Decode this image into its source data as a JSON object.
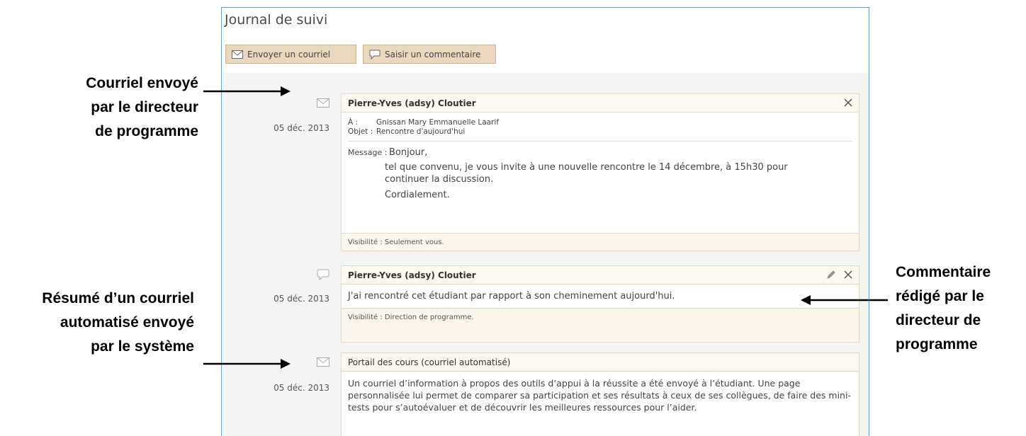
{
  "annotations": {
    "email_sent": [
      "Courriel envoyé",
      "par le directeur",
      "de programme"
    ],
    "auto_email": [
      "Résumé d’un courriel",
      "automatisé envoyé",
      "par le système"
    ],
    "comment": [
      "Commentaire",
      "rédigé par le",
      "directeur de",
      "programme"
    ]
  },
  "panel": {
    "title": "Journal de suivi",
    "buttons": {
      "email": "Envoyer un courriel",
      "comment": "Saisir un commentaire"
    }
  },
  "entries": {
    "email": {
      "icon": "envelope-icon",
      "date": "05 déc. 2013",
      "author": "Pierre-Yves (adsy) Cloutier",
      "to_label": "À :",
      "to_value": "Gnissan Mary Emmanuelle Laarif",
      "subject_label": "Objet :",
      "subject_value": "Rencontre d'aujourd'hui",
      "message_label": "Message :",
      "greeting": "Bonjour,",
      "body": "tel que convenu, je vous invite à une nouvelle rencontre le 14 décembre, à 15h30 pour continuer la discussion.",
      "closing": "Cordialement.",
      "visibility": "Visibilité : Seulement vous."
    },
    "comment": {
      "icon": "speech-bubble-icon",
      "date": "05 déc. 2013",
      "author": "Pierre-Yves (adsy) Cloutier",
      "text": "J'ai rencontré cet étudiant par rapport à son cheminement aujourd'hui.",
      "visibility": "Visibilité : Direction de programme."
    },
    "auto": {
      "icon": "envelope-icon",
      "date": "05 déc. 2013",
      "source": "Portail des cours (courriel automatisé)",
      "text": "Un courriel d’information à propos des outils d’appui à la réussite a été envoyé à l’étudiant. Une page personnalisée lui permet de comparer sa participation et ses résultats à ceux de ses collègues, de faire des mini-tests pour s’autoévaluer et de découvrir les meilleures ressources pour l’aider."
    }
  },
  "colors": {
    "panel_border": "#6a9fd4",
    "button_bg": "#e9d8bd",
    "card_bg": "#fbf7ee"
  }
}
